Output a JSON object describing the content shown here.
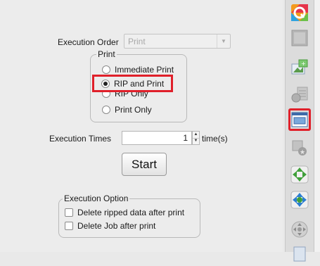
{
  "execution_order": {
    "label": "Execution Order",
    "selected_value": "Print"
  },
  "print_group": {
    "title": "Print",
    "options": [
      {
        "label": "Immediate Print",
        "checked": false
      },
      {
        "label": "RIP and Print",
        "checked": true
      },
      {
        "label": "RIP Only",
        "checked": false
      },
      {
        "label": "Print Only",
        "checked": false
      }
    ]
  },
  "execution_times": {
    "label": "Execution Times",
    "value": "1",
    "unit": "time(s)"
  },
  "start_button": {
    "label": "Start"
  },
  "execution_option": {
    "title": "Execution Option",
    "options": [
      {
        "label": "Delete ripped data after print",
        "checked": false
      },
      {
        "label": "Delete Job after print",
        "checked": false
      }
    ]
  },
  "toolbar": {
    "buttons": [
      {
        "icon": "color-q-icon"
      },
      {
        "icon": "blank-square-icon"
      },
      {
        "icon": "image-add-icon"
      },
      {
        "icon": "grid-settings-icon"
      },
      {
        "icon": "printer-window-icon",
        "selected": true
      },
      {
        "icon": "gear-star-icon"
      },
      {
        "icon": "green-arrows-icon"
      },
      {
        "icon": "blue-arrows-icon"
      },
      {
        "icon": "move-circle-icon"
      },
      {
        "icon": "document-icon"
      }
    ]
  },
  "colors": {
    "highlight": "#e0202a",
    "panel_bg": "#ececec"
  }
}
